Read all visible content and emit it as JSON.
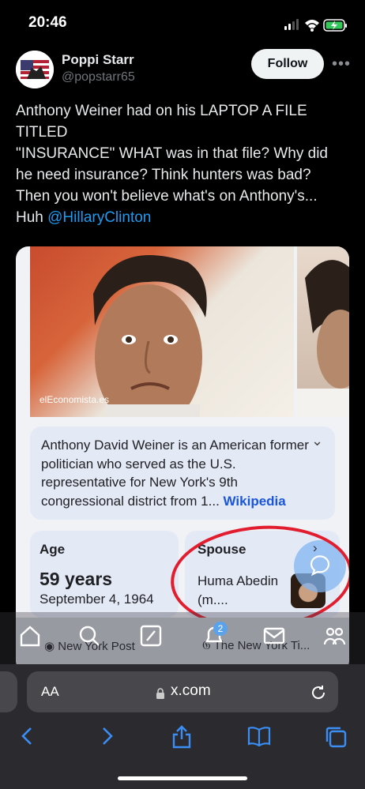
{
  "status_bar": {
    "time": "20:46"
  },
  "author": {
    "name": "Poppi Starr",
    "handle": "@popstarr65"
  },
  "follow_label": "Follow",
  "tweet": {
    "text": "Anthony Weiner had on his LAPTOP A FILE TITLED\n\"INSURANCE\" WHAT was in that file? Why did he need insurance? Think hunters was bad? Then you won't believe what's on Anthony's...\nHuh ",
    "mention": "@HillaryClinton"
  },
  "card": {
    "photo_credit": "elEconomista.es",
    "summary": "Anthony David Weiner is an American former politician who served as the U.S. representative for New York's 9th congressional district from 1... ",
    "summary_link": "Wikipedia",
    "age_label": "Age",
    "age_value": "59 years",
    "birth_date": "September 4, 1964",
    "spouse_label": "Spouse",
    "spouse_value": "Huma Abedin (m....",
    "sources": [
      "New York Post",
      "The New York Ti..."
    ]
  },
  "tab_bar": {
    "notification_count": "2",
    "icons": [
      "home-icon",
      "search-icon",
      "grok-icon",
      "notifications-icon",
      "messages-icon",
      "communities-icon"
    ]
  },
  "browser": {
    "text_size_label": "AA",
    "url": "x.com"
  },
  "colors": {
    "accent": "#1d9bf0",
    "annotation_red": "#e11d2e",
    "background": "#000000"
  }
}
